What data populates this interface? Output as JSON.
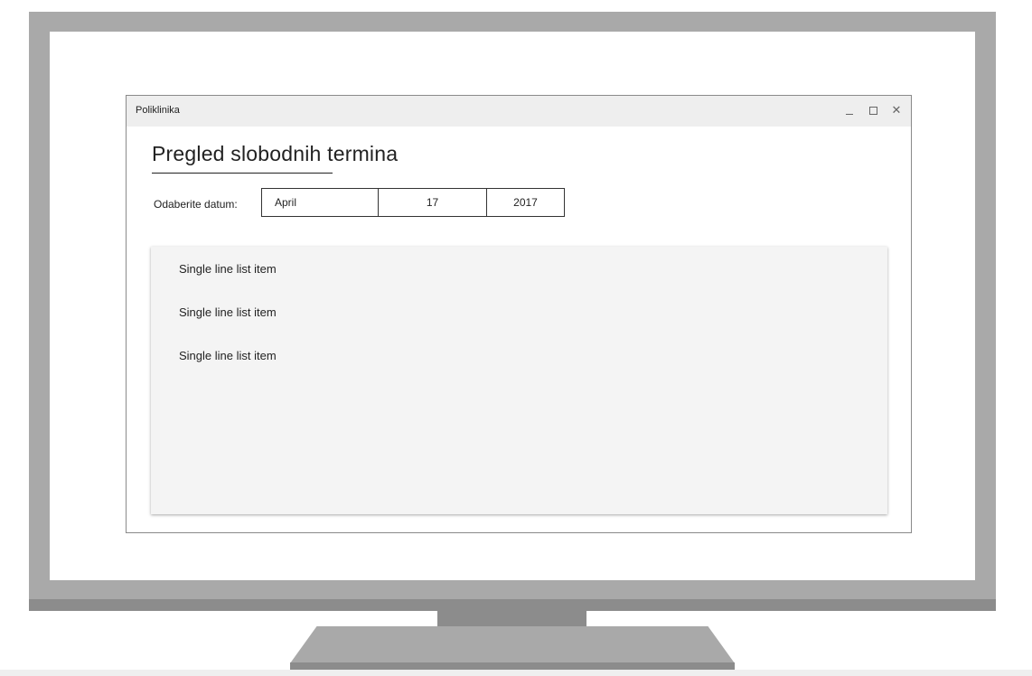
{
  "window": {
    "title": "Poliklinika"
  },
  "page": {
    "title": "Pregled slobodnih termina"
  },
  "date_selector": {
    "label": "Odaberite datum:",
    "month": "April",
    "day": "17",
    "year": "2017"
  },
  "list": {
    "items": [
      {
        "label": "Single line list item"
      },
      {
        "label": "Single line list item"
      },
      {
        "label": "Single line list item"
      }
    ]
  },
  "icons": {
    "minimize": "minimize-icon",
    "maximize": "maximize-icon",
    "close": "close-icon"
  },
  "colors": {
    "bezel": "#a9a9a9",
    "chin": "#8c8c8c",
    "titlebar": "#eeeeee",
    "list_background": "#f4f4f4"
  }
}
